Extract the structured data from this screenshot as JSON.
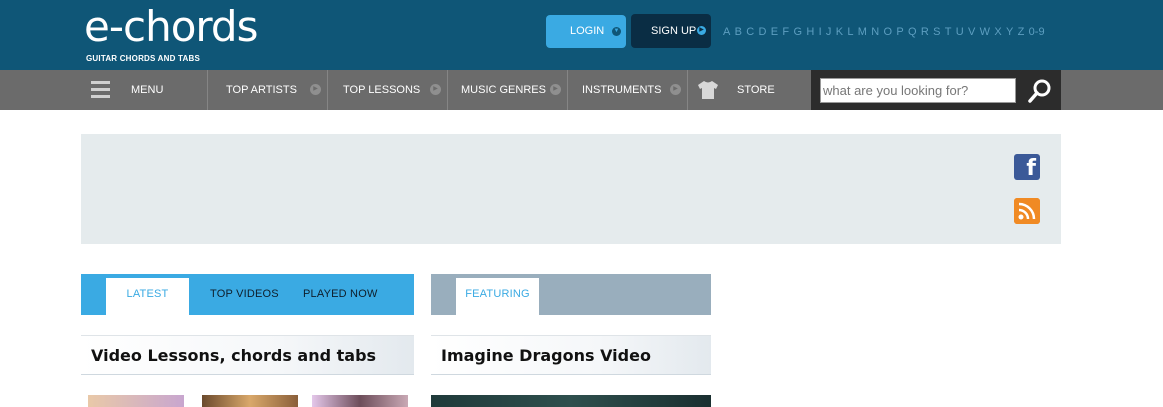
{
  "header": {
    "logo_text": "e-chords",
    "logo_tagline": "GUITAR CHORDS AND TABS",
    "login_label": "LOGIN",
    "signup_label": "SIGN UP",
    "alphabet": [
      "A",
      "B",
      "C",
      "D",
      "E",
      "F",
      "G",
      "H",
      "I",
      "J",
      "K",
      "L",
      "M",
      "N",
      "O",
      "P",
      "Q",
      "R",
      "S",
      "T",
      "U",
      "V",
      "W",
      "X",
      "Y",
      "Z",
      "0-9"
    ]
  },
  "nav": {
    "menu_label": "MENU",
    "top_artists": "TOP ARTISTS",
    "top_lessons": "TOP LESSONS",
    "music_genres": "MUSIC GENRES",
    "instruments": "INSTRUMENTS",
    "store": "STORE"
  },
  "search": {
    "placeholder": "what are you looking for?"
  },
  "left_panel": {
    "tabs": {
      "latest": "LATEST",
      "top_videos": "TOP VIDEOS",
      "played_now": "PLAYED NOW"
    },
    "title": "Video Lessons, chords and tabs"
  },
  "right_panel": {
    "tabs": {
      "featuring": "FEATURING"
    },
    "title": "Imagine Dragons Video"
  },
  "social": {
    "facebook_glyph": "f"
  },
  "colors": {
    "header_bg": "#0f5677",
    "nav_bg": "#6b6b6b",
    "accent": "#3aaae3",
    "banner_bg": "#e5ebed"
  }
}
